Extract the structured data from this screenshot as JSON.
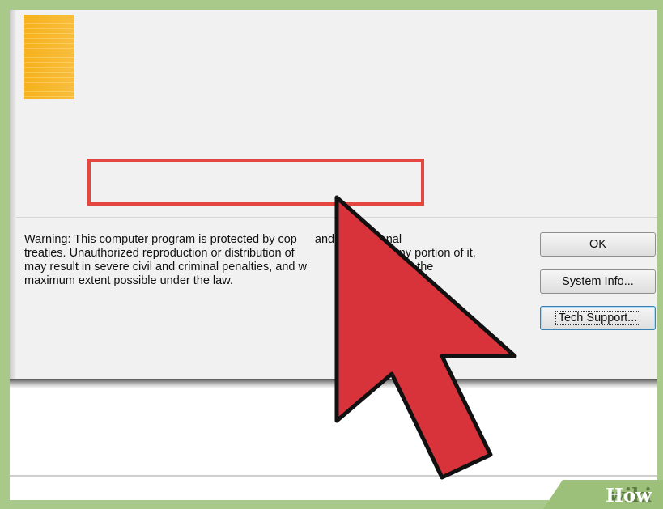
{
  "dialog": {
    "warning_lines": [
      "Warning: This computer program is protected by cop",
      "treaties. Unauthorized reproduction or distribution of",
      "may result in severe civil and criminal penalties, and w",
      "maximum extent possible under the law."
    ],
    "warning_right": [
      "and international",
      ", or any portion of it,",
      "d to the",
      ""
    ],
    "buttons": {
      "ok": "OK",
      "system_info": "System Info...",
      "tech_support": "Tech Support..."
    }
  },
  "overlay": {
    "cursor_icon": "arrow-pointer-icon",
    "cursor_color": "#d8323a",
    "highlight_color": "#e54640"
  },
  "watermark": {
    "wiki": "wiki",
    "how": "How"
  }
}
